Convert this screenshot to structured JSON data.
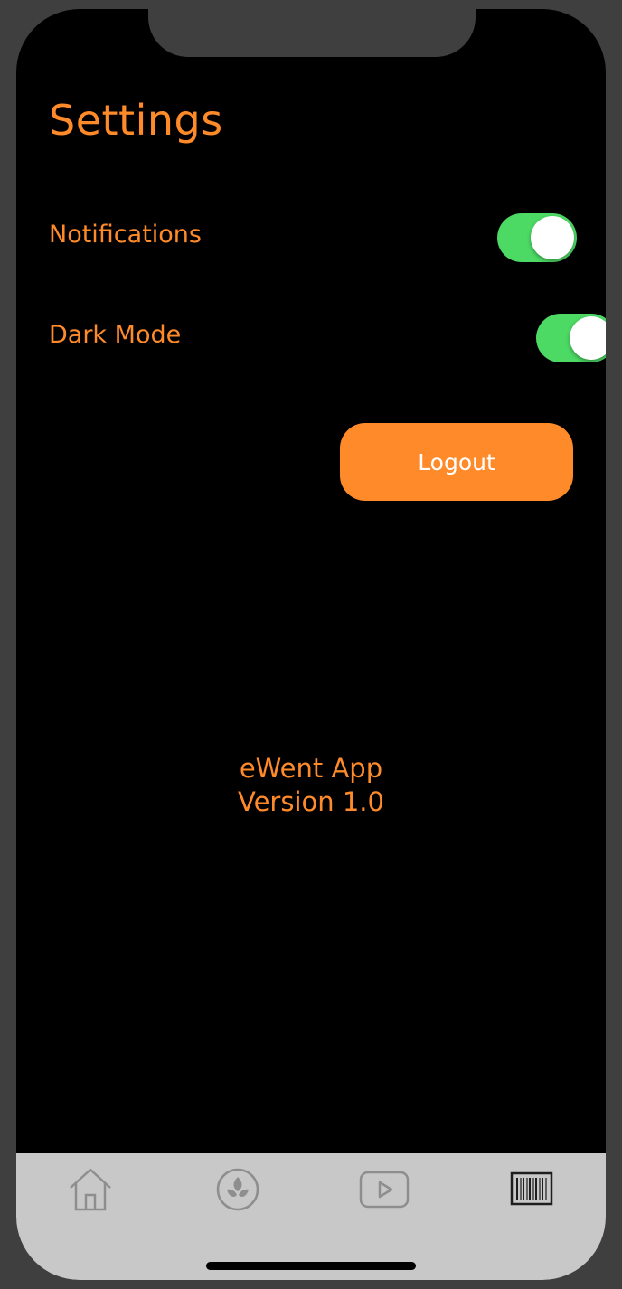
{
  "page": {
    "title": "Settings"
  },
  "settings": {
    "notifications": {
      "label": "Notifications",
      "enabled": true
    },
    "dark_mode": {
      "label": "Dark Mode",
      "enabled": true
    }
  },
  "actions": {
    "logout_label": "Logout"
  },
  "about": {
    "app_name": "eWent App",
    "version": "Version 1.0"
  },
  "tab_bar": {
    "tabs": [
      {
        "icon": "home-icon",
        "selected": false
      },
      {
        "icon": "leaf-icon",
        "selected": false
      },
      {
        "icon": "play-icon",
        "selected": false
      },
      {
        "icon": "barcode-icon",
        "selected": true
      }
    ]
  },
  "colors": {
    "accent": "#ff8a2a",
    "toggle_on": "#4cd964",
    "background": "#000000",
    "tab_bar": "#c8c8c8",
    "tab_icon_inactive": "#8e8e8e",
    "tab_icon_active": "#1e1e1e"
  }
}
